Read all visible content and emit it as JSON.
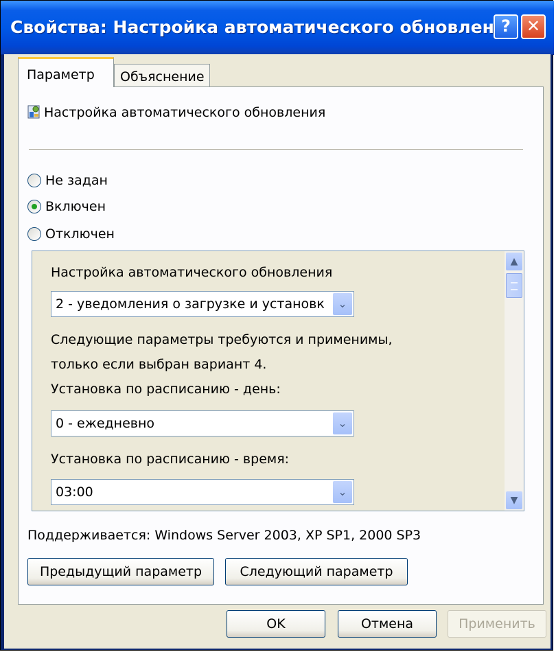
{
  "window": {
    "title": "Свойства: Настройка автоматического обновления",
    "help_label": "?",
    "close_label": "✕"
  },
  "tabs": [
    {
      "label": "Параметр",
      "selected": true
    },
    {
      "label": "Объяснение",
      "selected": false
    }
  ],
  "policy": {
    "icon": "policy-settings-icon",
    "name": "Настройка автоматического обновления"
  },
  "radios": [
    {
      "label": "Не задан",
      "checked": false
    },
    {
      "label": "Включен",
      "checked": true
    },
    {
      "label": "Отключен",
      "checked": false
    }
  ],
  "options": {
    "heading": "Настройка автоматического обновления",
    "mode_value": "2 - уведомления о загрузке и установк",
    "note_line1": "Следующие параметры требуются и применимы,",
    "note_line2": "только если выбран вариант 4.",
    "day_label": "Установка по расписанию - день:",
    "day_value": "0 - ежедневно",
    "time_label": "Установка по расписанию - время:",
    "time_value": "03:00",
    "arrow_glyph": "⌄",
    "scroll_up_glyph": "▲",
    "scroll_down_glyph": "▼"
  },
  "supported": "Поддерживается:  Windows Server 2003, XP SP1, 2000 SP3",
  "buttons": {
    "prev": "Предыдущий параметр",
    "next": "Следующий параметр",
    "ok": "OK",
    "cancel": "Отмена",
    "apply": "Применить"
  },
  "colors": {
    "titlebar": "#0058e6",
    "dialog_bg": "#ece9d8",
    "tab_accent": "#ffc83c",
    "radio_checked": "#21a121"
  }
}
